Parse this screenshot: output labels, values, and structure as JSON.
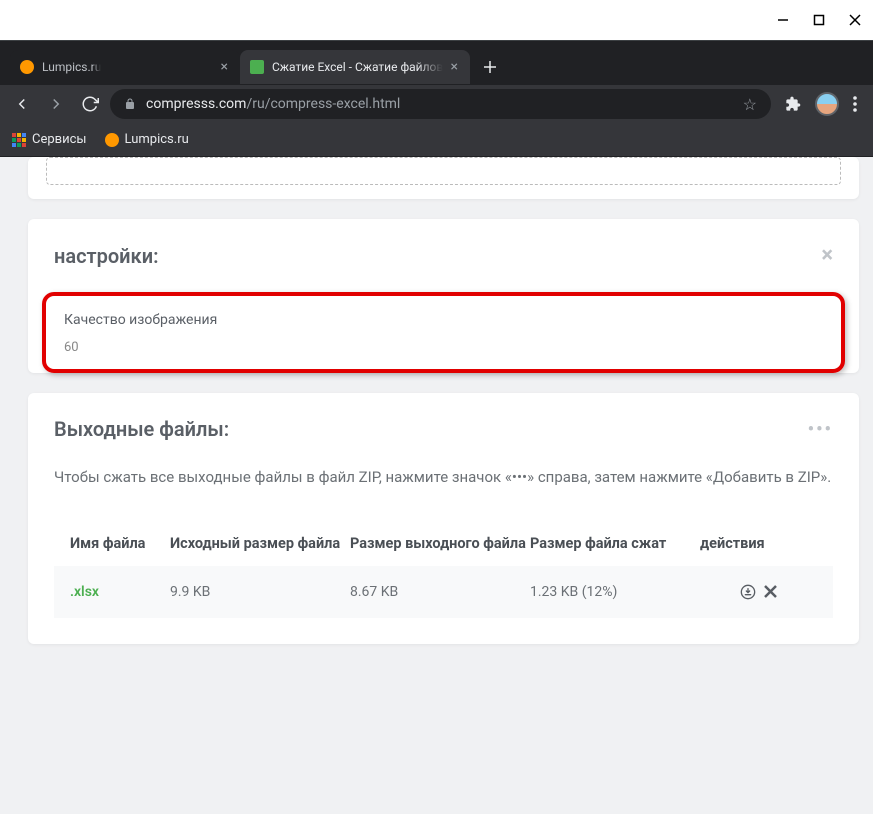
{
  "window": {
    "minimize": "—",
    "maximize": "▢",
    "close": "✕"
  },
  "tabs": [
    {
      "title": "Lumpics.ru"
    },
    {
      "title": "Сжатие Excel - Сжатие файлов X"
    }
  ],
  "url": {
    "domain": "compresss.com",
    "path": "/ru/compress-excel.html"
  },
  "bookmarks": {
    "services": "Сервисы",
    "lumpics": "Lumpics.ru"
  },
  "settings": {
    "title": "настройки:",
    "quality_label": "Качество изображения",
    "quality_value": "60"
  },
  "output": {
    "title": "Выходные файлы:",
    "hint": "Чтобы сжать все выходные файлы в файл ZIP, нажмите значок «•••» справа, затем нажмите «Добавить в ZIP».",
    "headers": {
      "name": "Имя файла",
      "src_size": "Исходный размер файла",
      "out_size": "Размер выходного файла",
      "compressed": "Размер файла сжат",
      "actions": "действия"
    },
    "row": {
      "name": ".xlsx",
      "src_size": "9.9 KB",
      "out_size": "8.67 KB",
      "compressed": "1.23 KB (12%)"
    }
  }
}
